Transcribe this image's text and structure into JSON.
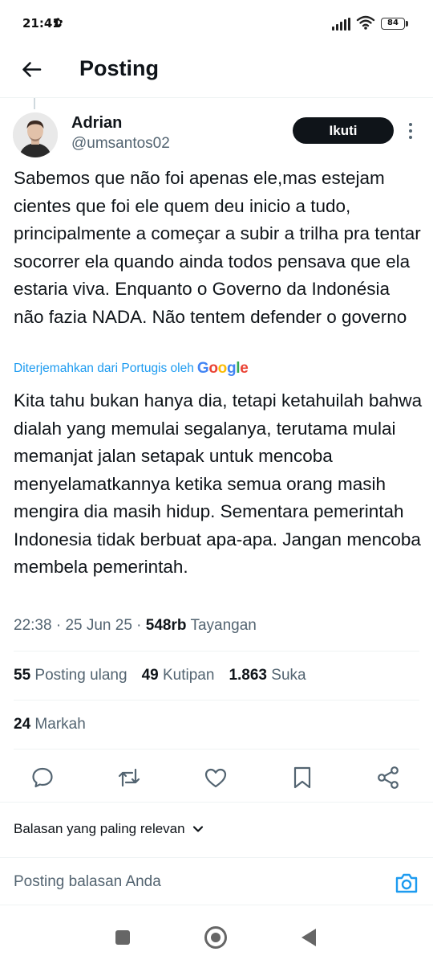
{
  "status_bar": {
    "time": "21:41",
    "battery": "84"
  },
  "header": {
    "title": "Posting",
    "back_icon": "arrow-left-icon"
  },
  "post": {
    "author": {
      "name": "Adrian",
      "handle": "@umsantos02"
    },
    "follow_label": "Ikuti",
    "text": "Sabemos que não foi apenas ele,mas estejam cientes que foi ele quem deu inicio a tudo, principalmente a começar a subir a trilha pra tentar socorrer ela quando ainda todos pensava que ela estaria viva. Enquanto o Governo da Indonésia não fazia NADA. Não tentem defender o governo",
    "translated_by": "Diterjemahkan dari Portugis oleh",
    "translator_brand": {
      "text": "Google",
      "letters": [
        {
          "char": "G",
          "color": "#4285F4"
        },
        {
          "char": "o",
          "color": "#EA4335"
        },
        {
          "char": "o",
          "color": "#FBBC05"
        },
        {
          "char": "g",
          "color": "#4285F4"
        },
        {
          "char": "l",
          "color": "#34A853"
        },
        {
          "char": "e",
          "color": "#EA4335"
        }
      ]
    },
    "translation": "Kita tahu bukan hanya dia, tetapi ketahuilah bahwa dialah yang memulai segalanya, terutama mulai memanjat jalan setapak untuk mencoba menyelamatkannya ketika semua orang masih mengira dia masih hidup. Sementara pemerintah Indonesia tidak berbuat apa-apa. Jangan mencoba membela pemerintah.",
    "meta": {
      "time": "22:38",
      "sep1": " · ",
      "date": "25 Jun 25",
      "sep2": " · ",
      "views": "548rb",
      "views_label": "Tayangan"
    },
    "stats": {
      "reposts": "55",
      "reposts_label": "Posting ulang",
      "quotes": "49",
      "quotes_label": "Kutipan",
      "likes": "1.863",
      "likes_label": "Suka"
    },
    "bookmarks": {
      "count": "24",
      "label": "Markah"
    }
  },
  "actions": {
    "reply_icon": "reply-icon",
    "repost_icon": "repost-icon",
    "like_icon": "heart-icon",
    "bookmark_icon": "bookmark-icon",
    "share_icon": "share-icon"
  },
  "replies": {
    "sort_label": "Balasan yang paling relevan"
  },
  "composer": {
    "placeholder": "Posting balasan Anda"
  },
  "colors": {
    "accent": "#1d9bf0",
    "text_primary": "#0f1419",
    "text_secondary": "#536471",
    "follow_bg": "#0f1419"
  }
}
